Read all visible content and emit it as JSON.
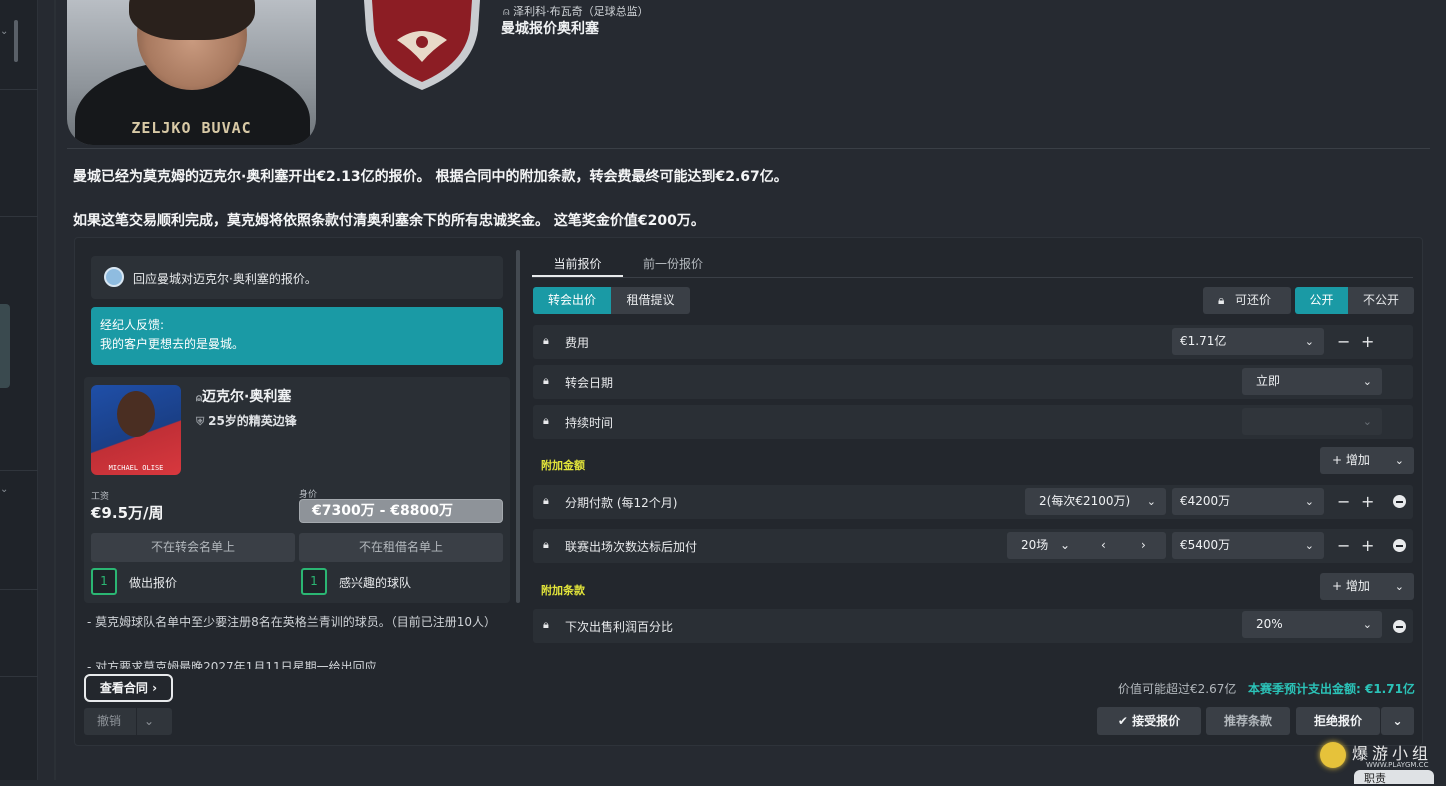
{
  "header": {
    "coach_name_on_photo": "ZELJKO BUVAC",
    "sender": "泽利科·布瓦奇（足球总监）",
    "subject": "曼城报价奥利塞"
  },
  "body": {
    "para1": "曼城已经为莫克姆的迈克尔·奥利塞开出€2.13亿的报价。 根据合同中的附加条款，转会费最终可能达到€2.67亿。",
    "para2": "如果这笔交易顺利完成，莫克姆将依照条款付清奥利塞余下的所有忠诚奖金。 这笔奖金价值€200万。"
  },
  "left_panel": {
    "message": "回应曼城对迈克尔·奥利塞的报价。",
    "agent_title": "经纪人反馈:",
    "agent_text": "我的客户更想去的是曼城。",
    "player": {
      "photo_name": "MICHAEL OLISE",
      "name": "迈克尔·奥利塞",
      "desc": "25岁的精英边锋",
      "wage_label": "工资",
      "wage": "€9.5万/周",
      "value_label": "身价",
      "value": "€7300万 - €8800万"
    },
    "not_transfer_listed": "不在转会名单上",
    "not_loan_listed": "不在租借名单上",
    "offers_count": "1",
    "offers_label": "做出报价",
    "interested_count": "1",
    "interested_label": "感兴趣的球队",
    "note1": "- 莫克姆球队名单中至少要注册8名在英格兰青训的球员。（目前已注册10人）",
    "note2": "- 对方要求莫克姆最晚2027年1月11日星期一给出回应",
    "view_contract": "查看合同",
    "cancel": "撤销"
  },
  "right_panel": {
    "tab_current": "当前报价",
    "tab_previous": "前一份报价",
    "seg_transfer": "转会出价",
    "seg_loan": "租借提议",
    "negotiable": "可还价",
    "public": "公开",
    "private": "不公开",
    "rows": {
      "fee_label": "费用",
      "fee_value": "€1.71亿",
      "date_label": "转会日期",
      "date_value": "立即",
      "duration_label": "持续时间",
      "duration_value": ""
    },
    "add_ons_title": "附加金额",
    "add_button": "增加",
    "installments_label": "分期付款 (每12个月)",
    "installments_select": "2(每次€2100万)",
    "installments_value": "€4200万",
    "appearances_label": "联赛出场次数达标后加付",
    "appearances_select": "20场",
    "appearances_value": "€5400万",
    "clauses_title": "附加条款",
    "sellon_label": "下次出售利润百分比",
    "sellon_value": "20%",
    "footer_exceed": "价值可能超过€2.67亿",
    "footer_season": "本赛季预计支出金额: €1.71亿",
    "accept": "接受报价",
    "suggest": "推荐条款",
    "reject": "拒绝报价"
  },
  "watermark": {
    "title": "爆游小组",
    "url": "WWW.PLAYGM.CC",
    "tag": "职责"
  },
  "colors": {
    "accent_teal": "#1a9aa5",
    "add_on_yellow": "#e3e53a",
    "positive_green": "#2bb673"
  }
}
